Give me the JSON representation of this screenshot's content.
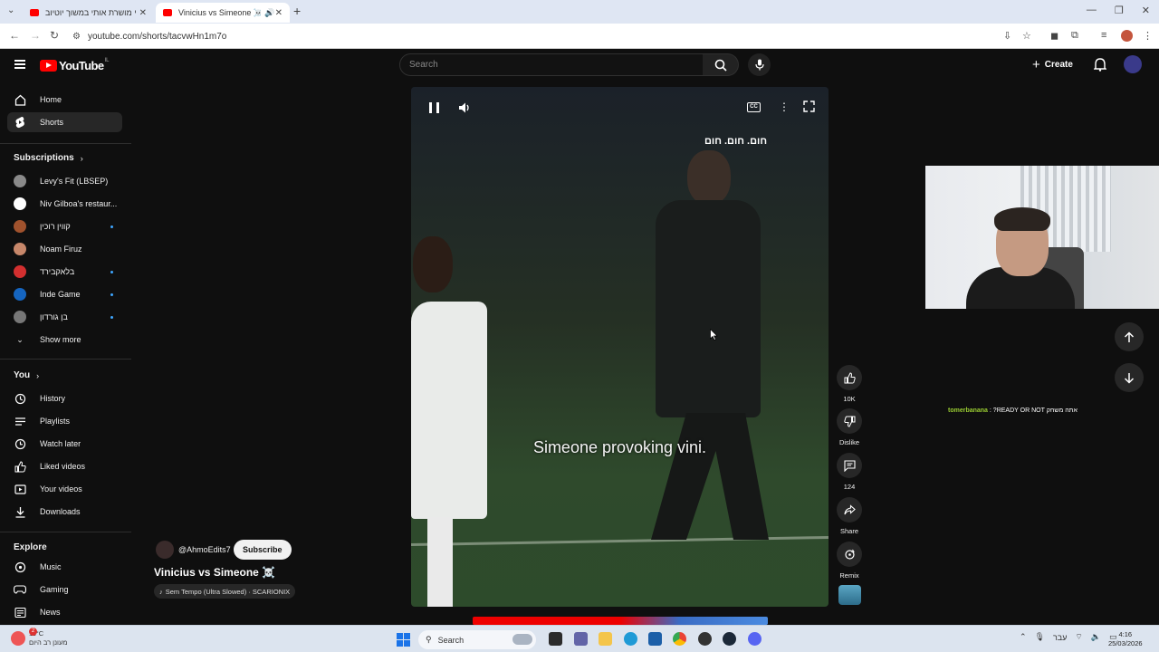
{
  "browser": {
    "tabs": [
      {
        "title": "חבר שלי מושרת אותי במשוך יוטיוב",
        "active": false
      },
      {
        "title": "Vinicius vs Simeone ☠️ - YouTube",
        "active": true
      }
    ],
    "url": "youtube.com/shorts/tacvwHn1m7o"
  },
  "masthead": {
    "logo_text": "YouTube",
    "country_code": "IL",
    "search_placeholder": "Search",
    "create_label": "Create"
  },
  "sidebar": {
    "main": [
      {
        "label": "Home",
        "icon": "home-icon"
      },
      {
        "label": "Shorts",
        "icon": "shorts-icon",
        "active": true
      }
    ],
    "subscriptions_heading": "Subscriptions",
    "subscriptions": [
      {
        "label": "Levy's Fit (LBSEP)",
        "color": "#8a8a8a",
        "new": false
      },
      {
        "label": "Niv Gilboa's restaur...",
        "color": "#ffffff",
        "new": false
      },
      {
        "label": "קווין רוכין",
        "color": "#a0522d",
        "new": true
      },
      {
        "label": "Noam Firuz",
        "color": "#c7876a",
        "new": false
      },
      {
        "label": "בלאקבירד",
        "color": "#d32f2f",
        "new": true
      },
      {
        "label": "Inde Game",
        "color": "#1565c0",
        "new": true
      },
      {
        "label": "בן גורדון",
        "color": "#777777",
        "new": true
      }
    ],
    "show_more": "Show more",
    "you_heading": "You",
    "you_items": [
      {
        "label": "History",
        "icon": "history-icon"
      },
      {
        "label": "Playlists",
        "icon": "playlists-icon"
      },
      {
        "label": "Watch later",
        "icon": "watch-later-icon"
      },
      {
        "label": "Liked videos",
        "icon": "like-icon"
      },
      {
        "label": "Your videos",
        "icon": "your-videos-icon"
      },
      {
        "label": "Downloads",
        "icon": "download-icon"
      }
    ],
    "explore_heading": "Explore",
    "explore_items": [
      {
        "label": "Music",
        "icon": "music-icon"
      },
      {
        "label": "Gaming",
        "icon": "gaming-icon"
      },
      {
        "label": "News",
        "icon": "news-icon"
      }
    ]
  },
  "short": {
    "overlay_text": "חום. חום. חום",
    "caption": "Simeone provoking vini.",
    "channel": "@AhmoEdits7",
    "subscribe_label": "Subscribe",
    "title": "Vinicius vs Simeone ☠️",
    "music": "Sem Tempo (Ultra Slowed) · SCARIONIX"
  },
  "actions": {
    "likes": "10K",
    "dislike": "Dislike",
    "comments": "124",
    "share": "Share",
    "remix": "Remix"
  },
  "chat": {
    "user": "tomerbanana",
    "message": ": ?READY OR NOT אתה משחק"
  },
  "taskbar": {
    "temperature": "11°C",
    "weather": "מעונן רב היום",
    "search": "Search",
    "lang": "עבר",
    "time": "4:16",
    "date": "25/03/2026",
    "badge": "2"
  }
}
